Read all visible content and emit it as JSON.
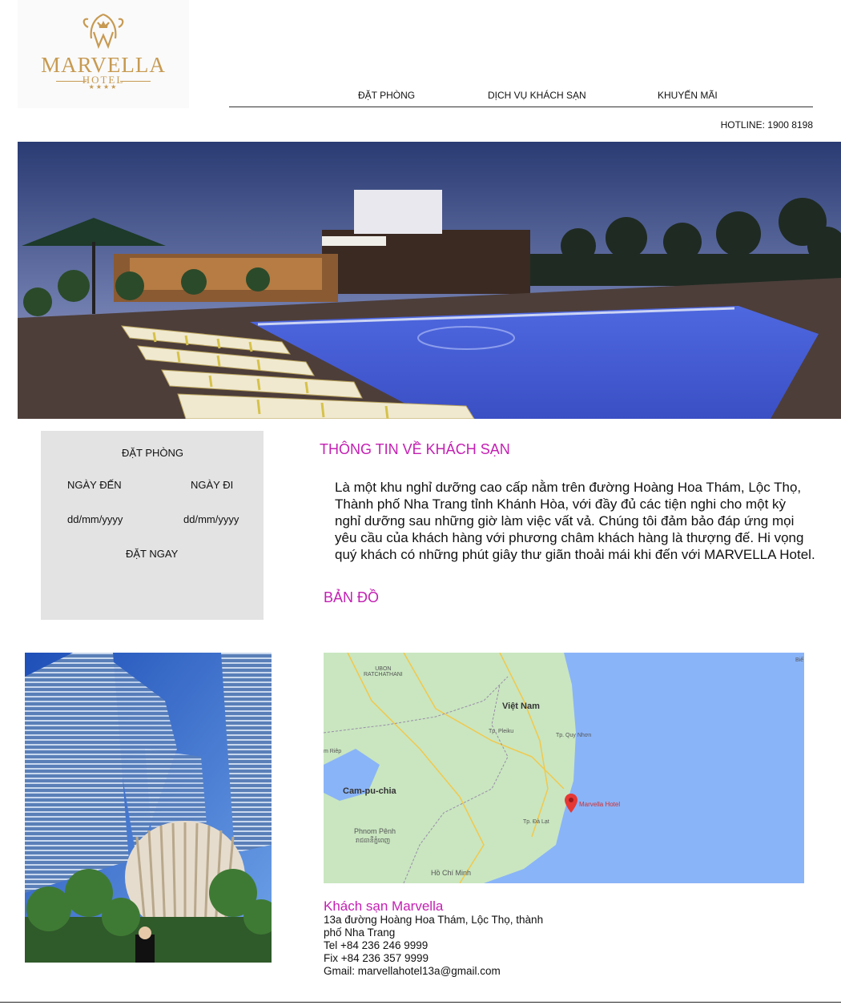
{
  "brand": {
    "name": "MARVELLA",
    "sub": "HOTEL",
    "stars": "★★★★",
    "color": "#c79a52"
  },
  "nav": {
    "items": [
      "ĐẶT PHÒNG",
      "DỊCH VỤ KHÁCH SẠN",
      "KHUYẾN MÃI"
    ],
    "hotline": "HOTLINE: 1900 8198"
  },
  "booking": {
    "title": "ĐẶT PHÒNG",
    "arrive_label": "NGÀY ĐẾN",
    "depart_label": "NGÀY ĐI",
    "arrive_value": "dd/mm/yyyy",
    "depart_value": "dd/mm/yyyy",
    "button": "ĐẶT NGAY"
  },
  "info": {
    "title": "THÔNG TIN VỀ KHÁCH SẠN",
    "lines": [
      "Là một khu nghỉ dưỡng cao cấp nằm trên đường Hoàng Hoa Thám, Lộc Thọ,",
      "Thành phố Nha Trang tỉnh Khánh Hòa, với  đầy đủ các tiện nghi cho một kỳ",
      "nghỉ dưỡng sau những giờ làm việc vất vả. Chúng tôi đảm bảo đáp ứng mọi",
      "yêu cầu của khách hàng với phương châm khách hàng là thượng đế. Hi vọng",
      "quý khách có những phút giây thư giãn thoải mái khi đến với MARVELLA Hotel."
    ]
  },
  "map": {
    "title": "BẢN ĐỒ",
    "labels": {
      "vietnam": "Việt Nam",
      "cambodia": "Cam-pu-chia",
      "phnom_penh": "Phnom Pênh",
      "phnom_penh_khmer": "រាជធានីភ្នំពេញ",
      "hcm": "Hồ Chí Minh",
      "marker": "Marvella Hotel",
      "pleiku": "Tp. Pleiku",
      "quynhon": "Tp. Quy Nhơn",
      "dalat": "Tp. Đà Lạt",
      "ubon": "UBON\nRATCHATHANI",
      "bien": "Biể",
      "left": "m Riêp"
    },
    "land": "#c9e6c0",
    "sea": "#8ab4f8"
  },
  "contact": {
    "name": "Khách sạn Marvella",
    "address1": "13a đường Hoàng Hoa Thám, Lộc Thọ, thành",
    "address2": "phố Nha Trang",
    "tel": "Tel +84 236 246 9999",
    "fax": "Fix +84 236 357 9999",
    "email": "Gmail: marvellahotel13a@gmail.com"
  },
  "accent": "#c41fb3"
}
